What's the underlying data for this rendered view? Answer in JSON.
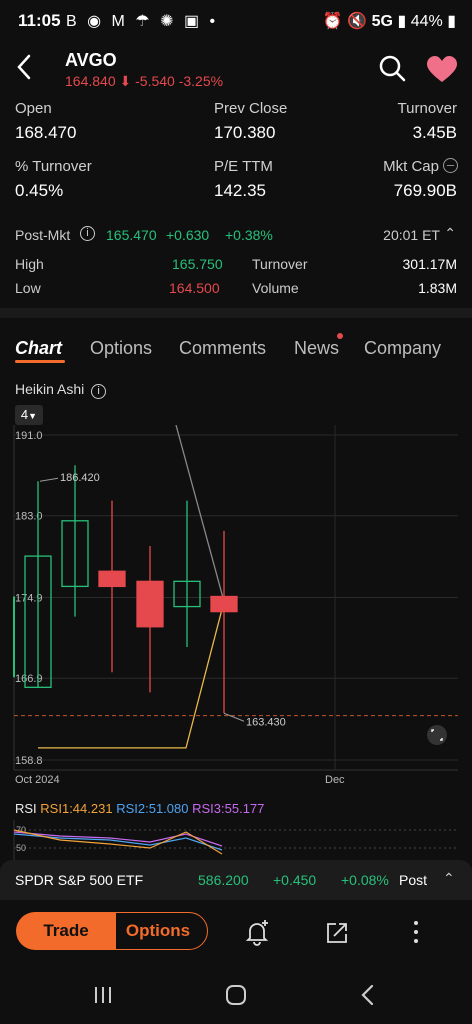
{
  "status_bar": {
    "time": "11:05",
    "left_icons": "B ◉ M ☂ ✺ ▣ •",
    "network": "5G",
    "battery": "44%"
  },
  "header": {
    "symbol": "AVGO",
    "price": "164.840",
    "change": "-5.540",
    "change_pct": "-3.25%"
  },
  "stats": {
    "row1": [
      {
        "label": "Open",
        "value": "168.470"
      },
      {
        "label": "Prev Close",
        "value": "170.380"
      },
      {
        "label": "Turnover",
        "value": "3.45B"
      }
    ],
    "row2": [
      {
        "label": "% Turnover",
        "value": "0.45%"
      },
      {
        "label": "P/E TTM",
        "value": "142.35"
      },
      {
        "label": "Mkt Cap",
        "value": "769.90B"
      }
    ]
  },
  "post_market": {
    "label": "Post-Mkt",
    "price": "165.470",
    "change": "+0.630",
    "change_pct": "+0.38%",
    "time": "20:01 ET"
  },
  "post_stats": {
    "high_label": "High",
    "high_value": "165.750",
    "low_label": "Low",
    "low_value": "164.500",
    "turnover_label": "Turnover",
    "turnover_value": "301.17M",
    "volume_label": "Volume",
    "volume_value": "1.83M"
  },
  "tabs": [
    "Chart",
    "Options",
    "Comments",
    "News",
    "Company"
  ],
  "chart": {
    "type_label": "Heikin Ashi",
    "period": "4"
  },
  "chart_data": {
    "type": "candlestick",
    "y_ticks": [
      "191.0",
      "183.0",
      "174.9",
      "166.9",
      "158.8"
    ],
    "x_ticks": [
      "Oct 2024",
      "Dec"
    ],
    "annotations": [
      {
        "label": "186.420"
      },
      {
        "label": "163.430"
      }
    ],
    "ylim": [
      158.8,
      191.0
    ],
    "candles": [
      {
        "open": 166.0,
        "close": 179.0,
        "high": 186.42,
        "low": 166.0
      },
      {
        "open": 176.0,
        "close": 182.5,
        "high": 188.0,
        "low": 173.0
      },
      {
        "open": 177.5,
        "close": 176.0,
        "high": 184.5,
        "low": 167.5
      },
      {
        "open": 176.5,
        "close": 172.0,
        "high": 180.0,
        "low": 165.5
      },
      {
        "open": 174.0,
        "close": 176.5,
        "high": 184.5,
        "low": 170.0
      },
      {
        "open": 175.0,
        "close": 173.5,
        "high": 181.5,
        "low": 163.43
      }
    ],
    "rsi": {
      "rsi1": "RSI1:44.231",
      "rsi2": "RSI2:51.080",
      "rsi3": "RSI3:55.177",
      "levels": [
        "70",
        "50"
      ]
    }
  },
  "bottom_ticker": {
    "name": "SPDR S&P 500 ETF",
    "price": "586.200",
    "change": "+0.450",
    "change_pct": "+0.08%",
    "session": "Post"
  },
  "toolbar": {
    "trade_label": "Trade",
    "options_label": "Options"
  },
  "colors": {
    "up": "#27c07a",
    "down": "#e5484d",
    "accent": "#f26b2a"
  }
}
